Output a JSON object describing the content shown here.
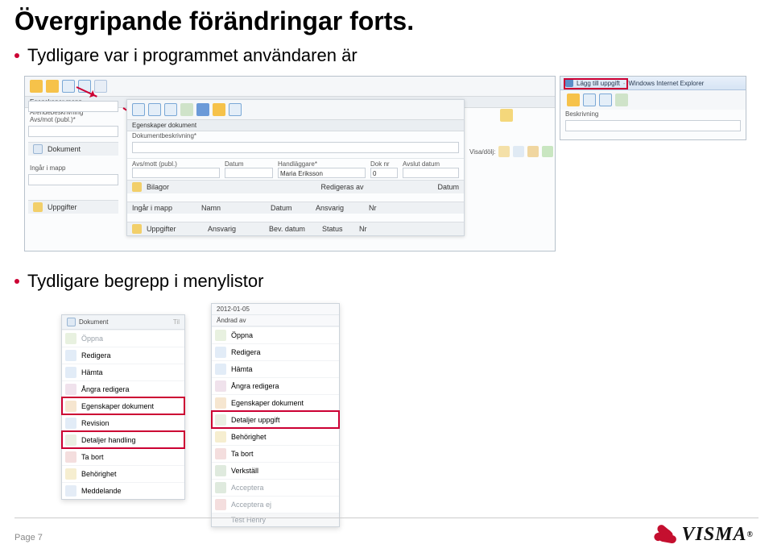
{
  "title": "Övergripande förändringar forts.",
  "bullet1": "Tydligare var i programmet användaren är",
  "bullet2": "Tydligare begrepp i menylistor",
  "page": "Page 7",
  "logo_text": "VISMA",
  "app_left": {
    "section_folder": "Egenskaper mapp",
    "folder_desc_label": "Ärendebeskrivning*",
    "sidebar_labels": {
      "avs_mot": "Avs/mot (publ.)*",
      "dokument": "Dokument",
      "ingar": "Ingår i mapp",
      "uppgifter": "Uppgifter"
    }
  },
  "app_doc": {
    "section": "Egenskaper dokument",
    "desc_label": "Dokumentbeskrivning*",
    "fields": {
      "avsmott": "Avs/mott (publ.)",
      "datum": "Datum",
      "handlaggare": "Handläggare*",
      "handlaggare_val": "Maria Eriksson",
      "doknr": "Dok nr",
      "doknr_val": "0",
      "avslut": "Avslut datum"
    },
    "rows": {
      "bilagor": "Bilagor",
      "redigeras": "Redigeras av",
      "datum2": "Datum",
      "ingar": "Ingår i mapp",
      "namn": "Namn",
      "datum3": "Datum",
      "ansvarig": "Ansvarig",
      "nr": "Nr",
      "uppgifter": "Uppgifter",
      "ansvarig2": "Ansvarig",
      "bevdatum": "Bev. datum",
      "status": "Status",
      "nr2": "Nr"
    },
    "visa_label": "Visa/dölj:"
  },
  "app_right": {
    "win_prefix": "Lägg till uppgift",
    "win_suffix": "Windows Internet Explorer",
    "beskrivning": "Beskrivning"
  },
  "menu_left": {
    "header": "Dokument",
    "items": [
      {
        "icon": "mi-open",
        "label": "Öppna",
        "dim": true,
        "grey_trail": "f.ll....../..t..."
      },
      {
        "icon": "mi-edit",
        "label": "Redigera"
      },
      {
        "icon": "mi-down",
        "label": "Hämta"
      },
      {
        "icon": "mi-undo",
        "label": "Ångra redigera"
      },
      {
        "icon": "mi-prop",
        "label": "Egenskaper dokument",
        "highlight": true
      },
      {
        "icon": "mi-rev",
        "label": "Revision"
      },
      {
        "icon": "mi-detail",
        "label": "Detaljer handling",
        "highlight": true
      },
      {
        "icon": "mi-delete",
        "label": "Ta bort"
      },
      {
        "icon": "mi-perm",
        "label": "Behörighet"
      },
      {
        "icon": "mi-msg",
        "label": "Meddelande"
      }
    ]
  },
  "menu_right": {
    "header_date": "2012-01-05",
    "header_line": "Ändrad av",
    "items": [
      {
        "icon": "mi-open",
        "label": "Öppna"
      },
      {
        "icon": "mi-edit",
        "label": "Redigera"
      },
      {
        "icon": "mi-down",
        "label": "Hämta"
      },
      {
        "icon": "mi-undo",
        "label": "Ångra redigera"
      },
      {
        "icon": "mi-prop",
        "label": "Egenskaper dokument"
      },
      {
        "icon": "mi-detail",
        "label": "Detaljer uppgift",
        "highlight": true
      },
      {
        "icon": "mi-perm",
        "label": "Behörighet"
      },
      {
        "icon": "mi-delete",
        "label": "Ta bort"
      },
      {
        "icon": "mi-verk",
        "label": "Verkställ"
      },
      {
        "icon": "mi-acc",
        "label": "Acceptera",
        "dim": true
      },
      {
        "icon": "mi-accno",
        "label": "Acceptera ej",
        "dim": true
      }
    ],
    "below_text": "Test Henry"
  }
}
